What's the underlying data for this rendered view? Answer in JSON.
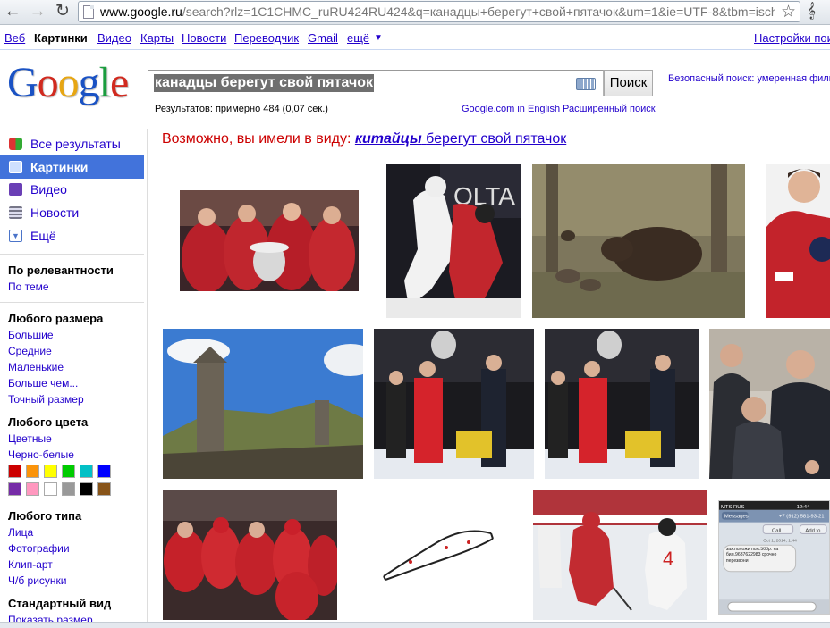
{
  "browser": {
    "url_host": "www.google.ru",
    "url_path": "/search?rlz=1C1CHMC_ruRU424RU424&q=канадцы+берегут+свой+пятачок&um=1&ie=UTF-8&tbm=isch",
    "back_glyph": "←",
    "forward_glyph": "→",
    "reload_glyph": "↻",
    "star_glyph": "☆",
    "wrench_glyph": "𝄞"
  },
  "gbar": {
    "items": [
      "Веб",
      "Картинки",
      "Видео",
      "Карты",
      "Новости",
      "Переводчик",
      "Gmail",
      "ещё"
    ],
    "more_caret": "▼",
    "settings": "Настройки поиска"
  },
  "logo": "Google",
  "search": {
    "query": "канадцы берегут свой пятачок",
    "button": "Поиск",
    "safe_search": "Безопасный поиск: умеренная фильтрация",
    "result_stats": "Результатов: примерно 484 (0,07 сек.)",
    "google_en": "Google.com in English",
    "advanced": "Расширенный поиск"
  },
  "suggestion": {
    "prefix": "Возможно, вы имели в виду:",
    "corrected_word": "китайцы",
    "rest": "берегут свой пятачок"
  },
  "sidebar": {
    "modes": [
      {
        "label": "Все результаты",
        "icon": "all-results-icon",
        "selected": false
      },
      {
        "label": "Картинки",
        "icon": "images-icon",
        "selected": true
      },
      {
        "label": "Видео",
        "icon": "video-icon",
        "selected": false
      },
      {
        "label": "Новости",
        "icon": "news-icon",
        "selected": false
      },
      {
        "label": "Ещё",
        "icon": "more-icon",
        "selected": false
      }
    ],
    "sort_heading": "По релевантности",
    "sort_by_topic": "По теме",
    "size_heading": "Любого размера",
    "sizes": [
      "Большие",
      "Средние",
      "Маленькие",
      "Больше чем...",
      "Точный размер"
    ],
    "color_heading": "Любого цвета",
    "colors_label": [
      "Цветные",
      "Черно-белые"
    ],
    "color_swatches": [
      "#cc0000",
      "#fb940b",
      "#ffff00",
      "#00cc00",
      "#03c0c6",
      "#0000ff",
      "#762ca7",
      "#ff98bf",
      "#ffffff",
      "#999999",
      "#000000",
      "#885418"
    ],
    "type_heading": "Любого типа",
    "types": [
      "Лица",
      "Фотографии",
      "Клип-арт",
      "Ч/б рисунки"
    ],
    "view_heading": "Стандартный вид",
    "view_show_size": "Показать размер"
  },
  "thumbnail_topics": [
    "hockey-team-trophy",
    "hockey-players-hug",
    "wild-boar-painting",
    "hockey-player-portrait",
    "mountain-tower",
    "trophy-ceremony-1",
    "trophy-ceremony-2",
    "officials-handshake",
    "hockey-team-celebration",
    "route-map",
    "hockey-game-action",
    "phone-sms-screenshot"
  ],
  "sms_screenshot": {
    "carrier": "MTS RUS",
    "time": "12:44",
    "messages_label": "Messages",
    "phone_number": "+7 (912) 581-93-21",
    "call": "Call",
    "add": "Add to",
    "date": "Oct 1, 2014, 1:44",
    "body": "зах.положи пож.500р. на бил.9637622983 срочно перезвони"
  }
}
